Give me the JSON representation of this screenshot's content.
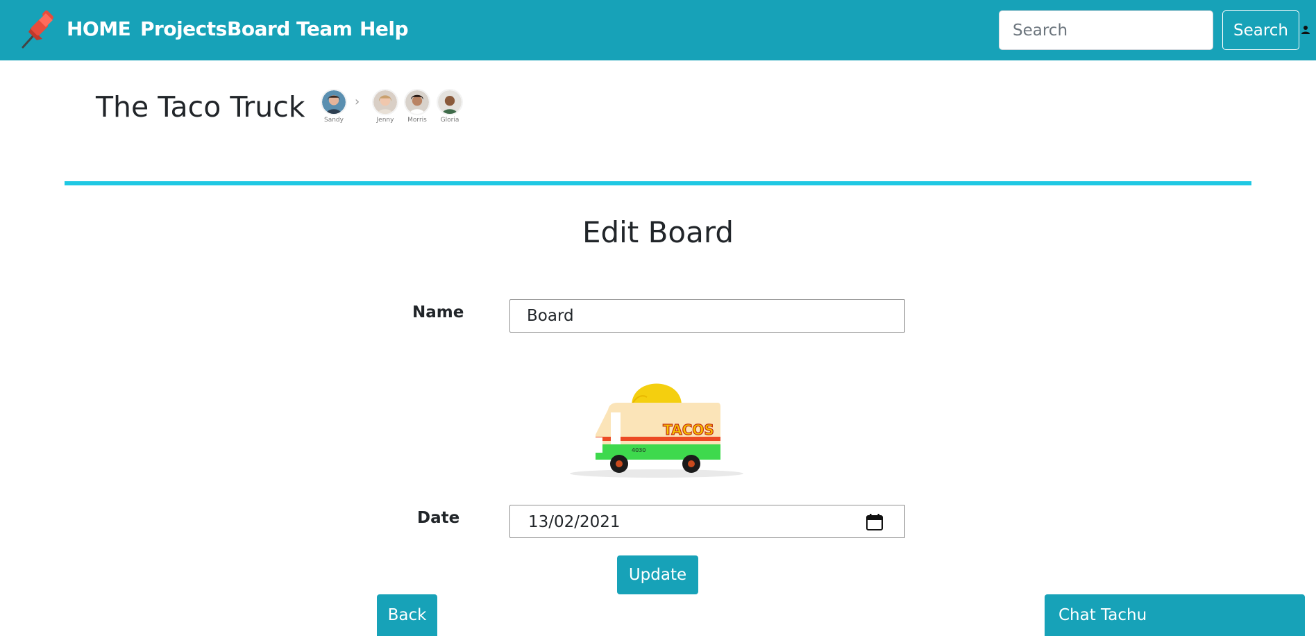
{
  "colors": {
    "navbar": "#17a2b8",
    "accent_rule": "#1fc8e3",
    "button": "#17a2b8"
  },
  "navbar": {
    "logo_icon": "pushpin-icon",
    "links": [
      "HOME",
      "Projects",
      "Board",
      "Team",
      "Help"
    ],
    "search": {
      "placeholder": "Search",
      "button_label": "Search"
    },
    "user_icon": "user-icon"
  },
  "project": {
    "title": "The Taco Truck",
    "members": [
      "Sandy",
      "Jenny",
      "Morris",
      "Gloria"
    ]
  },
  "form": {
    "heading": "Edit Board",
    "name_label": "Name",
    "name_value": "Board",
    "date_label": "Date",
    "date_value": "13/02/2021",
    "calendar_icon": "calendar-icon",
    "image_text": "TACOS",
    "image_plate": "4030",
    "update_label": "Update"
  },
  "footer": {
    "back_label": "Back",
    "chat_label": "Chat Tachu"
  }
}
